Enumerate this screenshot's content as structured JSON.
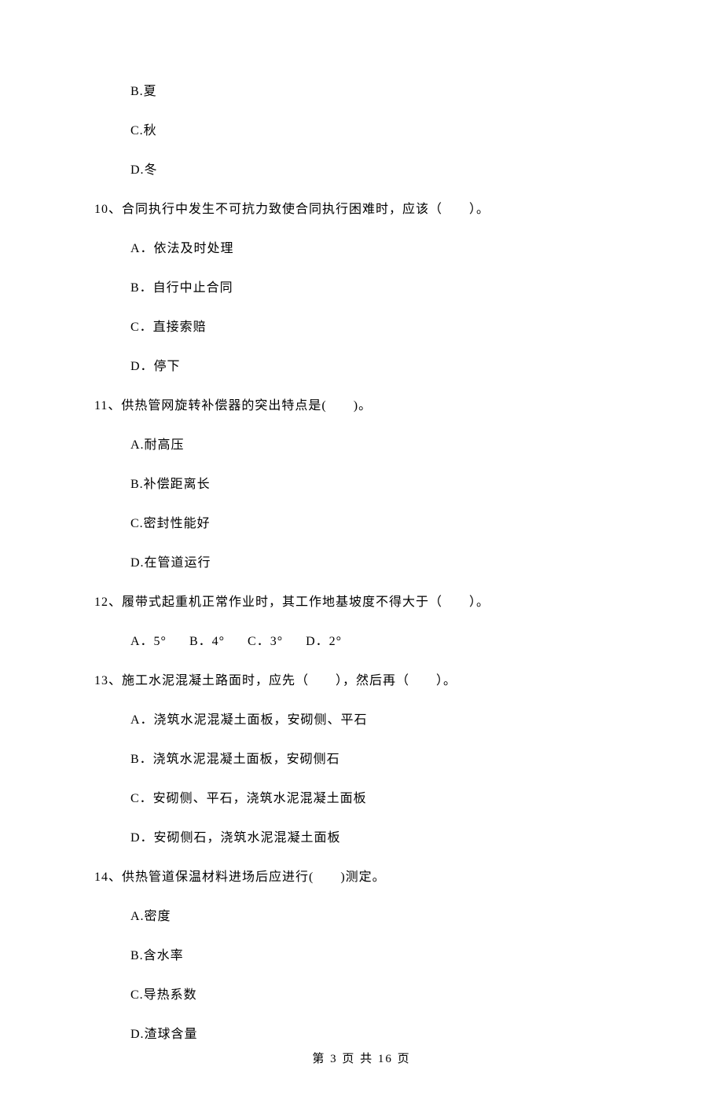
{
  "q9_options": {
    "b": "B.夏",
    "c": "C.秋",
    "d": "D.冬"
  },
  "q10": {
    "stem": "10、合同执行中发生不可抗力致使合同执行困难时，应该（　　）。",
    "a": "A．依法及时处理",
    "b": "B．自行中止合同",
    "c": "C．直接索赔",
    "d": "D．停下"
  },
  "q11": {
    "stem": "11、供热管网旋转补偿器的突出特点是(　　)。",
    "a": "A.耐高压",
    "b": "B.补偿距离长",
    "c": "C.密封性能好",
    "d": "D.在管道运行"
  },
  "q12": {
    "stem": "12、履带式起重机正常作业时，其工作地基坡度不得大于（　　）。",
    "a": "A．5°",
    "b": "B．4°",
    "c": "C．3°",
    "d": "D．2°"
  },
  "q13": {
    "stem": "13、施工水泥混凝土路面时，应先（　　），然后再（　　）。",
    "a": "A．浇筑水泥混凝土面板，安砌侧、平石",
    "b": "B．浇筑水泥混凝土面板，安砌侧石",
    "c": "C．安砌侧、平石，浇筑水泥混凝土面板",
    "d": "D．安砌侧石，浇筑水泥混凝土面板"
  },
  "q14": {
    "stem": "14、供热管道保温材料进场后应进行(　　)测定。",
    "a": "A.密度",
    "b": "B.含水率",
    "c": "C.导热系数",
    "d": "D.渣球含量"
  },
  "footer": "第 3 页 共 16 页"
}
